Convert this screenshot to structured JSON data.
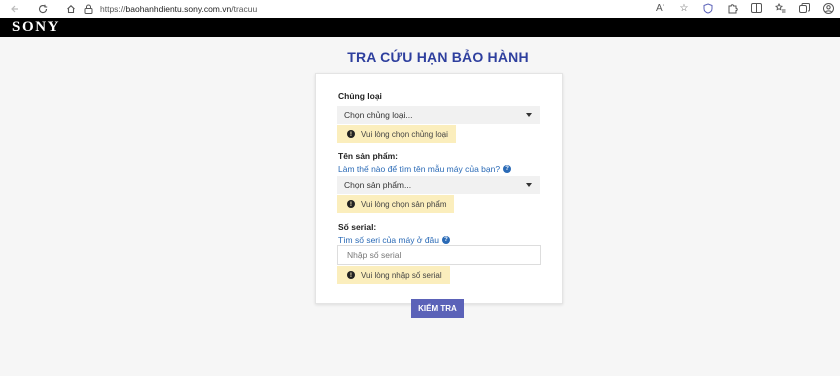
{
  "browser": {
    "url_prefix": "https://",
    "url_host": "baohanhdientu.sony.com.vn",
    "url_path": "/tracuu"
  },
  "brand": {
    "logo_text": "SONY"
  },
  "page": {
    "title": "TRA CỨU HẠN BẢO HÀNH"
  },
  "form": {
    "category": {
      "label": "Chủng loại",
      "selected": "Chọn chủng loại...",
      "warning": "Vui lòng chọn chủng loại"
    },
    "product": {
      "label": "Tên sản phẩm:",
      "help": "Làm thế nào để tìm tên mẫu máy của bạn?",
      "selected": "Chọn sản phẩm...",
      "warning": "Vui lòng chọn sản phẩm"
    },
    "serial": {
      "label": "Số serial:",
      "help": "Tìm số seri của máy ở đâu",
      "placeholder": "Nhập số serial",
      "warning": "Vui lòng nhập số serial"
    },
    "submit_label": "KIỂM TRA"
  },
  "colors": {
    "title": "#2e3f9e",
    "link": "#2a6ab6",
    "warning_bg": "#fbeebd",
    "button": "#5b62b8"
  }
}
